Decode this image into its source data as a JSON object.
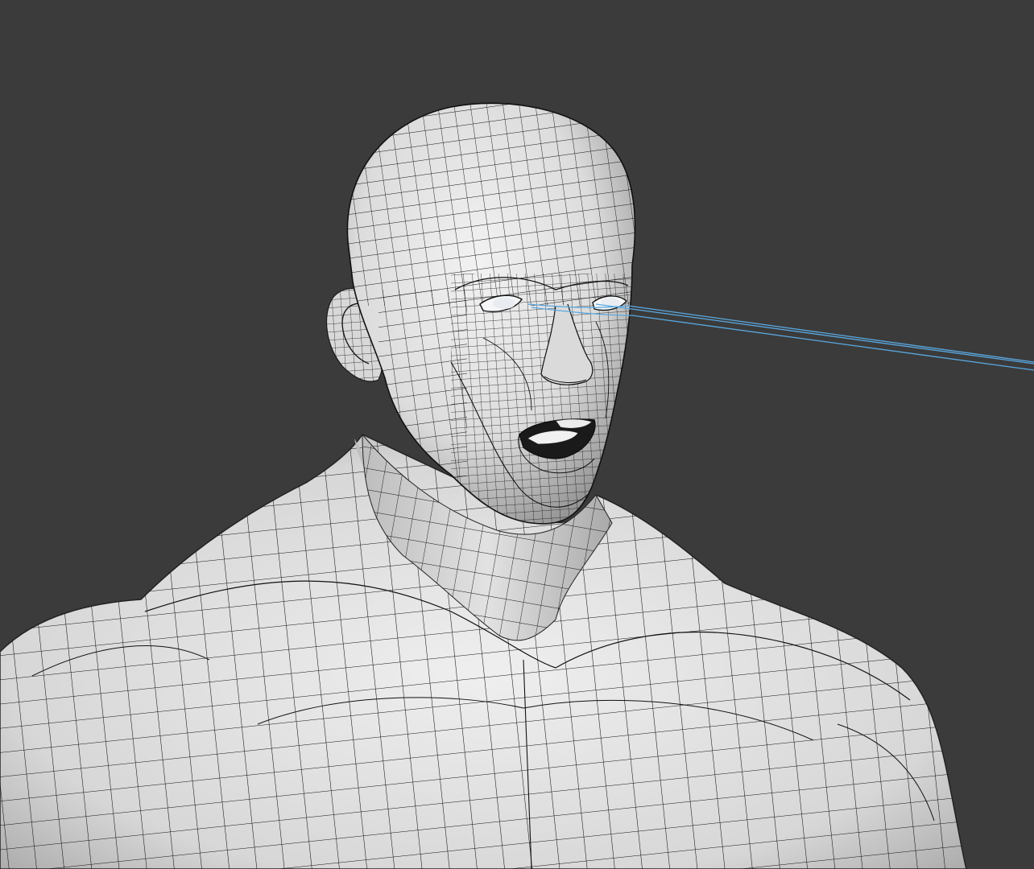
{
  "viewport": {
    "background_color": "#3b3b3b",
    "mesh_surface_color": "#e6e6e6",
    "mesh_wire_color": "#111111",
    "gaze_line_color": "#5aa8e0"
  }
}
